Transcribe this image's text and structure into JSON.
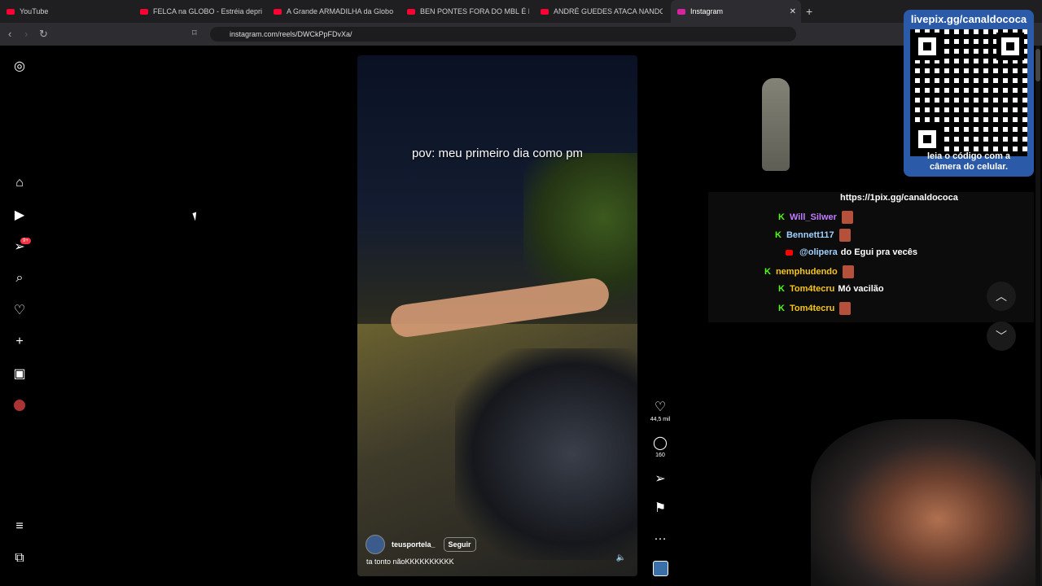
{
  "browser": {
    "tabs": [
      {
        "title": "YouTube"
      },
      {
        "title": "FELCA na GLOBO - Estréia depriment"
      },
      {
        "title": "A Grande ARMADILHA da Globo - Yo"
      },
      {
        "title": "BEN PONTES FORA DO MBL É BOM"
      },
      {
        "title": "ANDRÉ GUEDES ATACA NANDO MO"
      },
      {
        "title": "Instagram"
      }
    ],
    "url": "instagram.com/reels/DWCkPpFDvXa/"
  },
  "sidebar": {
    "notification_badge": "9+"
  },
  "reel": {
    "caption": "pov: meu primeiro dia como pm",
    "username": "teusportela_",
    "follow_label": "Seguir",
    "description": "ta tonto nãoKKKKKKKKKK"
  },
  "actions": {
    "likes": "44,5 mil",
    "comments": "160"
  },
  "stream_overlay": {
    "qr_title": "livepix.gg/canaldococa",
    "qr_caption_line1": "leia o código com a",
    "qr_caption_line2": "câmera do celular.",
    "chat_link": "https://1pix.gg/canaldococa",
    "chat": [
      {
        "platform": "kick",
        "user": "Will_Silwer",
        "message": "",
        "user_color": "#c17cff"
      },
      {
        "platform": "kick",
        "user": "Bennett117",
        "message": "",
        "user_color": "#9fd1ff"
      },
      {
        "platform": "youtube",
        "user": "@olipera",
        "message": "do Egui pra vecês",
        "user_color": "#9fd1ff"
      },
      {
        "platform": "kick",
        "user": "nemphudendo",
        "message": "",
        "user_color": "#f5c518"
      },
      {
        "platform": "kick",
        "user": "Tom4tecru",
        "message": "Mó vacilão",
        "user_color": "#f5c518"
      },
      {
        "platform": "kick",
        "user": "Tom4tecru",
        "message": "",
        "user_color": "#f5c518"
      }
    ]
  }
}
